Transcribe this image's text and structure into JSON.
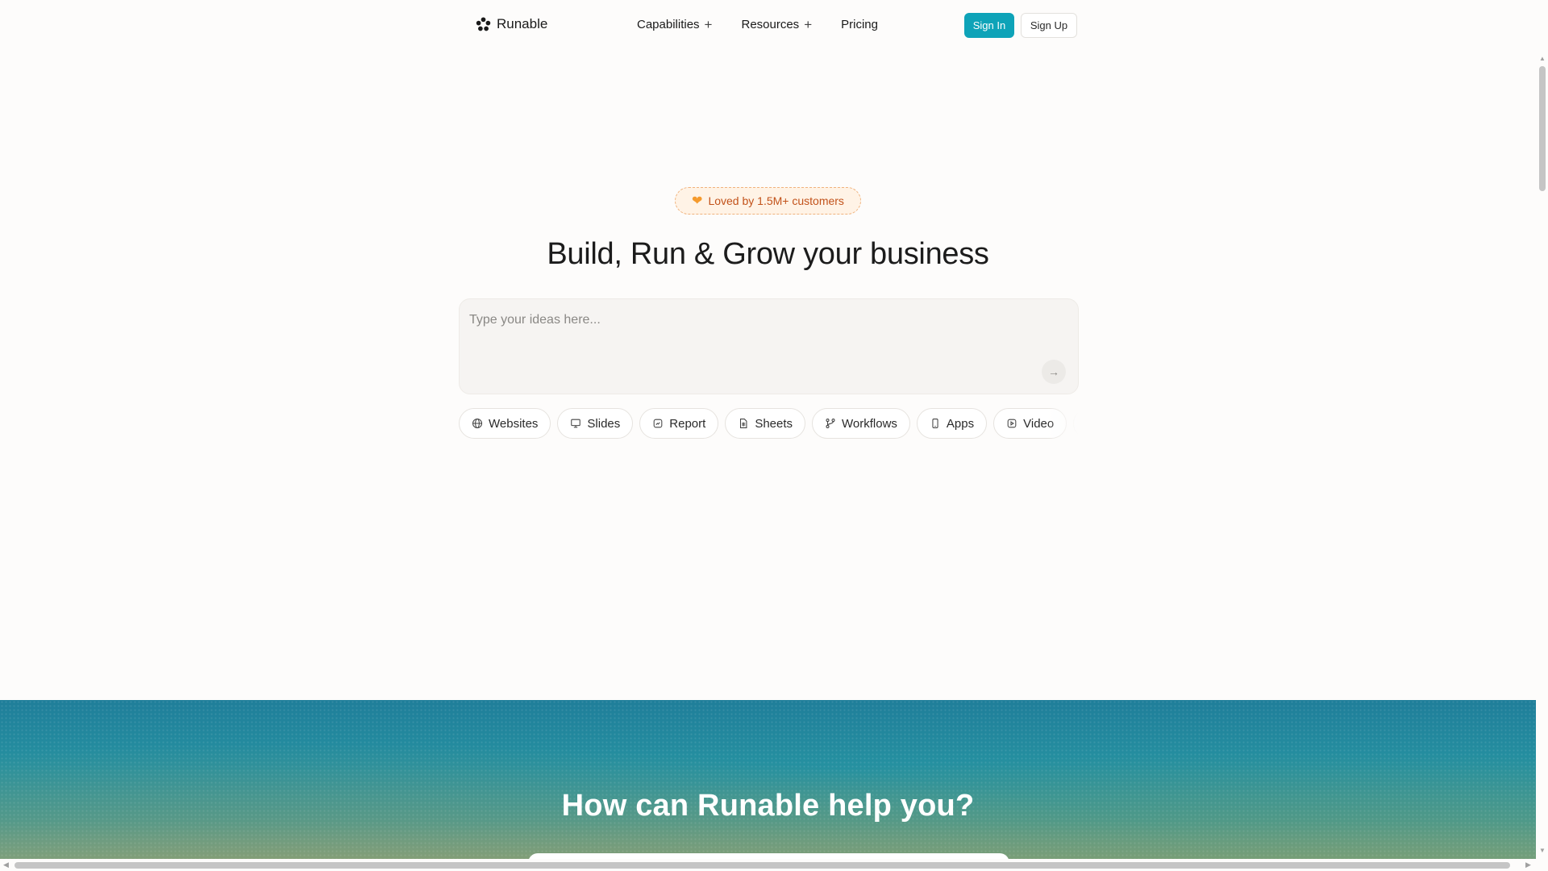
{
  "nav": {
    "brand": "Runable",
    "links": [
      {
        "label": "Capabilities",
        "expandable": true
      },
      {
        "label": "Resources",
        "expandable": true
      },
      {
        "label": "Pricing",
        "expandable": false
      }
    ],
    "sign_in": "Sign In",
    "sign_up": "Sign Up"
  },
  "hero": {
    "badge_icon": "heart-icon",
    "badge": "Loved by 1.5M+ customers",
    "title": "Build, Run & Grow your business",
    "prompt_placeholder": "Type your ideas here...",
    "prompt_value": ""
  },
  "chips": [
    {
      "label": "Websites",
      "icon": "globe-icon"
    },
    {
      "label": "Slides",
      "icon": "monitor-icon"
    },
    {
      "label": "Report",
      "icon": "report-icon"
    },
    {
      "label": "Sheets",
      "icon": "sheet-icon"
    },
    {
      "label": "Workflows",
      "icon": "workflow-icon"
    },
    {
      "label": "Apps",
      "icon": "phone-icon"
    },
    {
      "label": "Video",
      "icon": "video-icon"
    },
    {
      "label": "",
      "icon": "image-icon"
    }
  ],
  "help": {
    "title": "How can Runable help you?"
  },
  "colors": {
    "accent": "#0ea3b8",
    "badge_text": "#c2521a",
    "badge_bg": "#fff3e6"
  }
}
